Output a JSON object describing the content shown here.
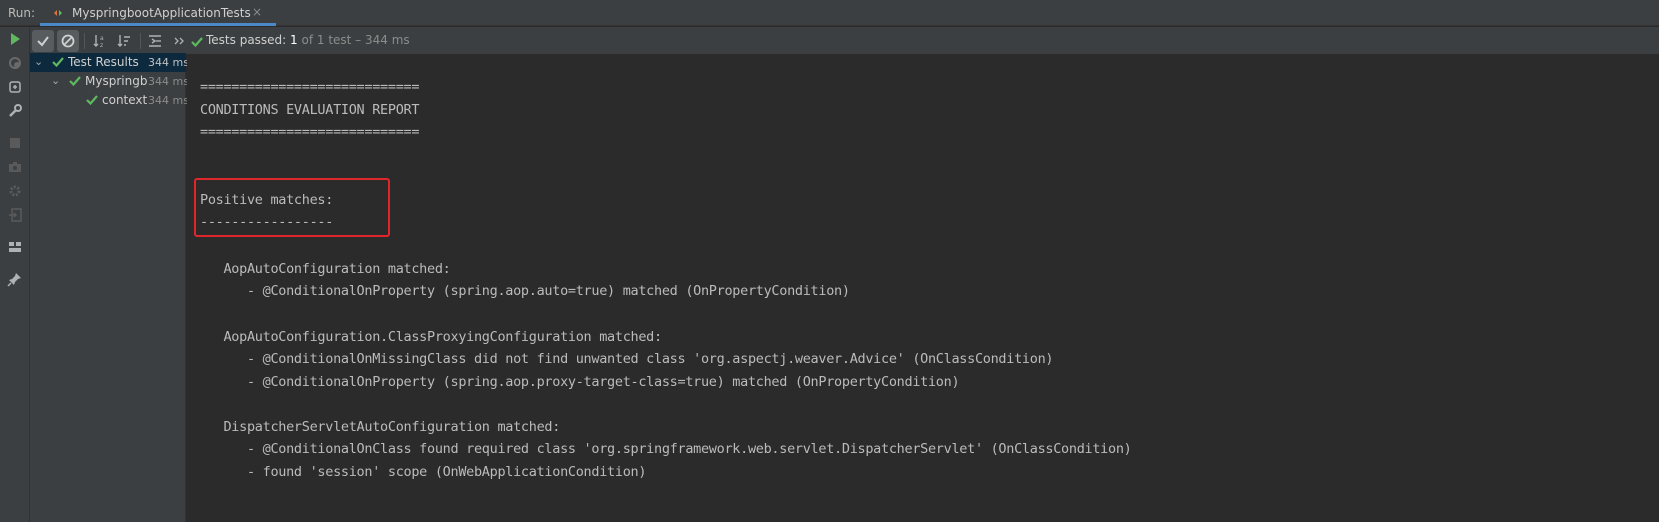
{
  "run_bar": {
    "label": "Run:",
    "tab_title": "MyspringbootApplicationTests",
    "tab_close": "×",
    "tab_icon": "run-config-icon"
  },
  "toolbar": {
    "status_label": "Tests passed: ",
    "status_count": "1",
    "status_rest": " of 1 test – 344 ms",
    "icons": [
      "rerun-icon",
      "show-passed-icon",
      "show-ignored-icon",
      "sort-alpha-icon",
      "sort-duration-icon",
      "collapse-icon",
      "more-icon"
    ]
  },
  "left_tools": [
    "play-icon",
    "rerun-failed-icon",
    "toggle-auto-test-icon",
    "wrench-icon",
    "stop-icon",
    "camera-icon",
    "settings-icon",
    "exit-icon",
    "layout-icon",
    "pin-icon"
  ],
  "tree": [
    {
      "name": "Test Results",
      "duration": "344 ms",
      "level": 0,
      "expanded": true,
      "selected": true
    },
    {
      "name": "Myspringb",
      "duration": "344 ms",
      "level": 1,
      "expanded": true,
      "selected": false
    },
    {
      "name": "contextl",
      "duration": "344 ms",
      "level": 2,
      "expanded": false,
      "selected": false
    }
  ],
  "console": {
    "lines": [
      "",
      "",
      "============================",
      "CONDITIONS EVALUATION REPORT",
      "============================",
      "",
      "",
      "Positive matches:",
      "-----------------",
      "",
      "   AopAutoConfiguration matched:",
      "      - @ConditionalOnProperty (spring.aop.auto=true) matched (OnPropertyCondition)",
      "",
      "   AopAutoConfiguration.ClassProxyingConfiguration matched:",
      "      - @ConditionalOnMissingClass did not find unwanted class 'org.aspectj.weaver.Advice' (OnClassCondition)",
      "      - @ConditionalOnProperty (spring.aop.proxy-target-class=true) matched (OnPropertyCondition)",
      "",
      "   DispatcherServletAutoConfiguration matched:",
      "      - @ConditionalOnClass found required class 'org.springframework.web.servlet.DispatcherServlet' (OnClassCondition)",
      "      - found 'session' scope (OnWebApplicationCondition)"
    ]
  },
  "colors": {
    "pass_green": "#5fb85f",
    "highlight_red": "#e0262a",
    "selection": "#0d293e",
    "tab_underline": "#4a88c7"
  }
}
